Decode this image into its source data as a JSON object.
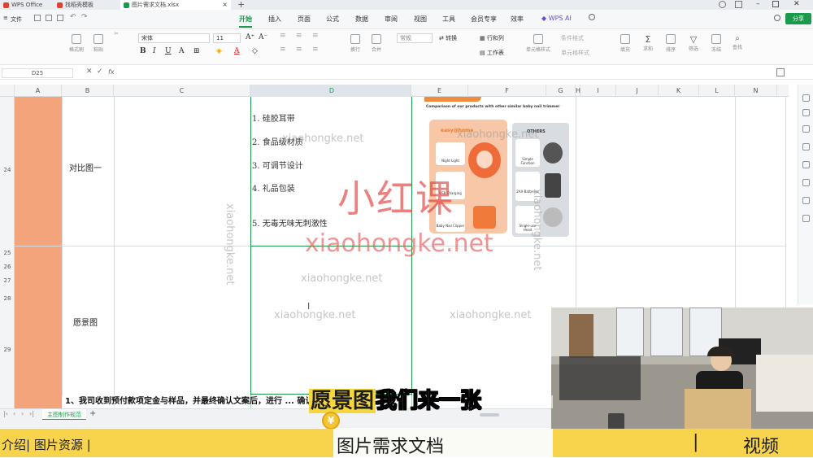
{
  "titlebar": {
    "tabs": [
      {
        "label": "WPS Office",
        "color": "#e0412e"
      },
      {
        "label": "找稻壳模板",
        "color": "#e0412e"
      },
      {
        "label": "图片需求文档.xlsx",
        "color": "#1a9b4b"
      }
    ]
  },
  "menubar": {
    "file_label": "文件",
    "items": [
      "开始",
      "插入",
      "页面",
      "公式",
      "数据",
      "审阅",
      "视图",
      "工具",
      "会员专享",
      "效率",
      "WPS AI"
    ],
    "active": "开始",
    "share_label": "分享"
  },
  "ribbon": {
    "font_name": "宋体",
    "font_size": "11",
    "format_painter": "格式刷",
    "paste": "粘贴",
    "wrap": "换行",
    "merge": "合并",
    "number_format": "常规",
    "convert": "转换",
    "row_col": "行和列",
    "worksheet": "工作表",
    "conditional_format": "条件格式",
    "cell_style": "单元格样式",
    "fill": "填充",
    "sum": "求和",
    "sort": "排序",
    "filter": "筛选",
    "freeze": "冻结",
    "find": "查找"
  },
  "formula_bar": {
    "cell_ref": "D25",
    "fx": "fx"
  },
  "grid": {
    "columns": [
      "A",
      "B",
      "C",
      "D",
      "E",
      "F",
      "G",
      "H",
      "I",
      "J",
      "K",
      "L",
      "N"
    ],
    "selected_column": "D",
    "rows": [
      "24",
      "25",
      "26",
      "27",
      "28",
      "29"
    ],
    "row24_label": "对比图一",
    "row29_label": "愿景图",
    "list": [
      "1. 硅胶耳带",
      "2. 食品级材质",
      "3. 可调节设计",
      "4. 礼品包装",
      "5. 无毒无味无刺激性"
    ]
  },
  "product_image": {
    "header": "Comparison of our products with other similar baby nail trimmer",
    "brand": "easy@home",
    "others_label": "OTHERS",
    "ours": [
      "Night Light",
      "USB Charging",
      "Baby Nail Clipper"
    ],
    "others": [
      "Simple Function",
      "2AA Batteries",
      "Single-use Head"
    ]
  },
  "watermarks": {
    "big_cn": "小红课",
    "big_en": "xiaohongke.net",
    "small": "xiaohongke.net"
  },
  "sheets": {
    "active": "主图制作规范",
    "add": "+"
  },
  "overlay": {
    "notice": "1、我司收到预付款项定金与样品，并最终确认文案后，进行 ... 确认需要",
    "subtitle_highlight": "愿景图",
    "subtitle_rest": "我们来一张",
    "coin": "¥",
    "bottom_left": "介绍|  图片资源 |",
    "bottom_mid": "图片需求文档",
    "bottom_right_sep": "|",
    "bottom_right": "视频"
  },
  "colors": {
    "accent": "#1a9b4b",
    "column_a": "#f4a47a",
    "caption_yellow": "#f8d44c"
  }
}
